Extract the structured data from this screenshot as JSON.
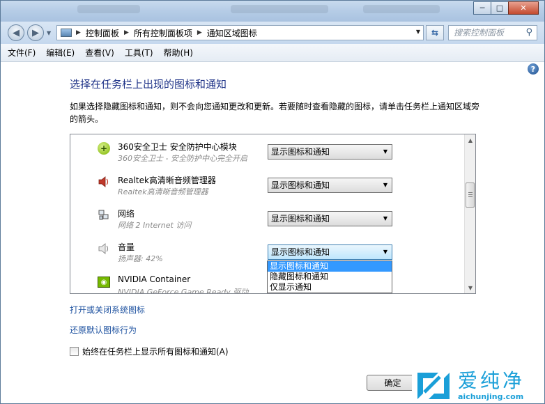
{
  "window": {
    "minimize": "─",
    "maximize": "□",
    "close": "✕"
  },
  "address": {
    "crumbs": [
      "控制面板",
      "所有控制面板项",
      "通知区域图标"
    ],
    "search_placeholder": "搜索控制面板"
  },
  "menu": [
    "文件(F)",
    "编辑(E)",
    "查看(V)",
    "工具(T)",
    "帮助(H)"
  ],
  "page": {
    "heading": "选择在任务栏上出现的图标和通知",
    "description": "如果选择隐藏图标和通知，则不会向您通知更改和更新。若要随时查看隐藏的图标，请单击任务栏上通知区域旁的箭头。"
  },
  "icons_list": [
    {
      "name": "360安全卫士 安全防护中心模块",
      "sub": "360安全卫士 - 安全防护中心完全开启",
      "behavior": "显示图标和通知",
      "icon": "shield-icon"
    },
    {
      "name": "Realtek高清晰音频管理器",
      "sub": "Realtek高清晰音频管理器",
      "behavior": "显示图标和通知",
      "icon": "speaker-icon"
    },
    {
      "name": "网络",
      "sub": "网络 2 Internet 访问",
      "behavior": "显示图标和通知",
      "icon": "network-icon"
    },
    {
      "name": "音量",
      "sub": "扬声器: 42%",
      "behavior": "显示图标和通知",
      "icon": "volume-icon"
    },
    {
      "name": "NVIDIA Container",
      "sub": "NVIDIA GeForce Game Ready 驱动...",
      "behavior": "",
      "icon": "nvidia-icon"
    }
  ],
  "dropdown_options": [
    "显示图标和通知",
    "隐藏图标和通知",
    "仅显示通知"
  ],
  "links": {
    "system_icons": "打开或关闭系统图标",
    "restore_defaults": "还原默认图标行为"
  },
  "always_show_label": "始终在任务栏上显示所有图标和通知(A)",
  "always_show_checked": false,
  "ok_button": "确定",
  "watermark": {
    "brand": "爱纯净",
    "url": "aichunjing.com"
  },
  "scroll_position": 0.33
}
